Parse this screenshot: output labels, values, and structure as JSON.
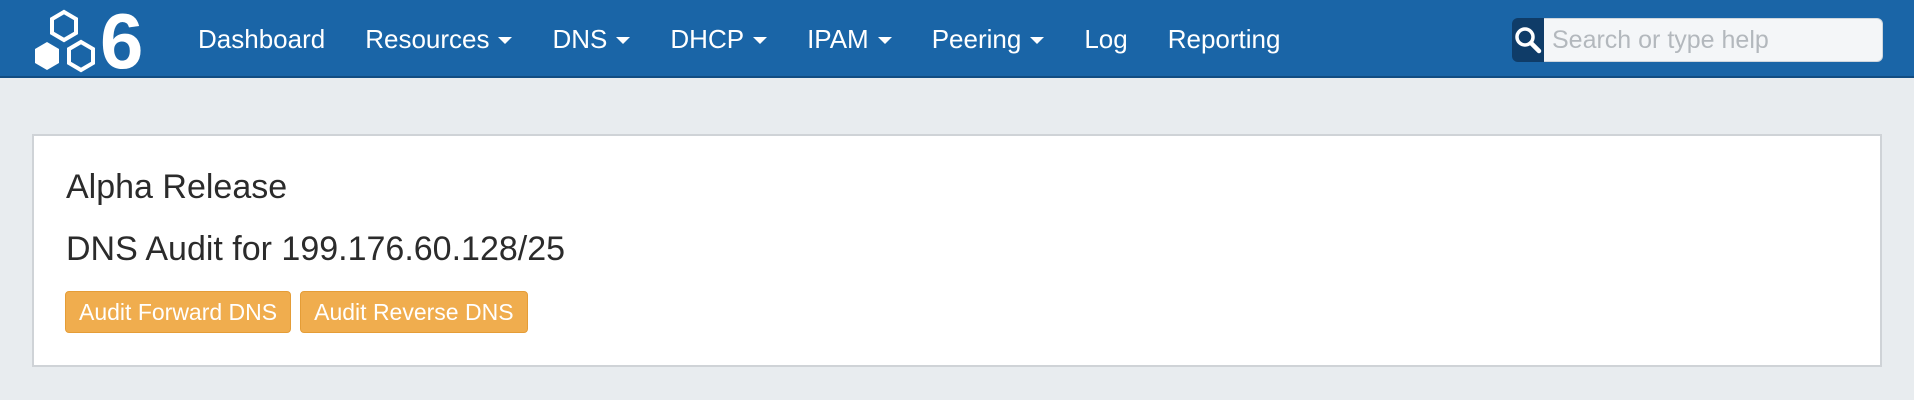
{
  "brand": {
    "logo_icon": "hexagon-cluster-six-logo-icon",
    "logo_text": "6"
  },
  "nav": {
    "items": [
      {
        "label": "Dashboard",
        "dropdown": false
      },
      {
        "label": "Resources",
        "dropdown": true
      },
      {
        "label": "DNS",
        "dropdown": true
      },
      {
        "label": "DHCP",
        "dropdown": true
      },
      {
        "label": "IPAM",
        "dropdown": true
      },
      {
        "label": "Peering",
        "dropdown": true
      },
      {
        "label": "Log",
        "dropdown": false
      },
      {
        "label": "Reporting",
        "dropdown": false
      }
    ]
  },
  "search": {
    "placeholder": "Search or type help",
    "value": "",
    "icon": "search-icon"
  },
  "panel": {
    "release_label": "Alpha Release",
    "title": "DNS Audit for 199.176.60.128/25",
    "buttons": {
      "forward": "Audit Forward DNS",
      "reverse": "Audit Reverse DNS"
    }
  },
  "colors": {
    "navbar": "#1a65a7",
    "accent_button": "#f0ad4e",
    "background": "#e8ecef"
  }
}
